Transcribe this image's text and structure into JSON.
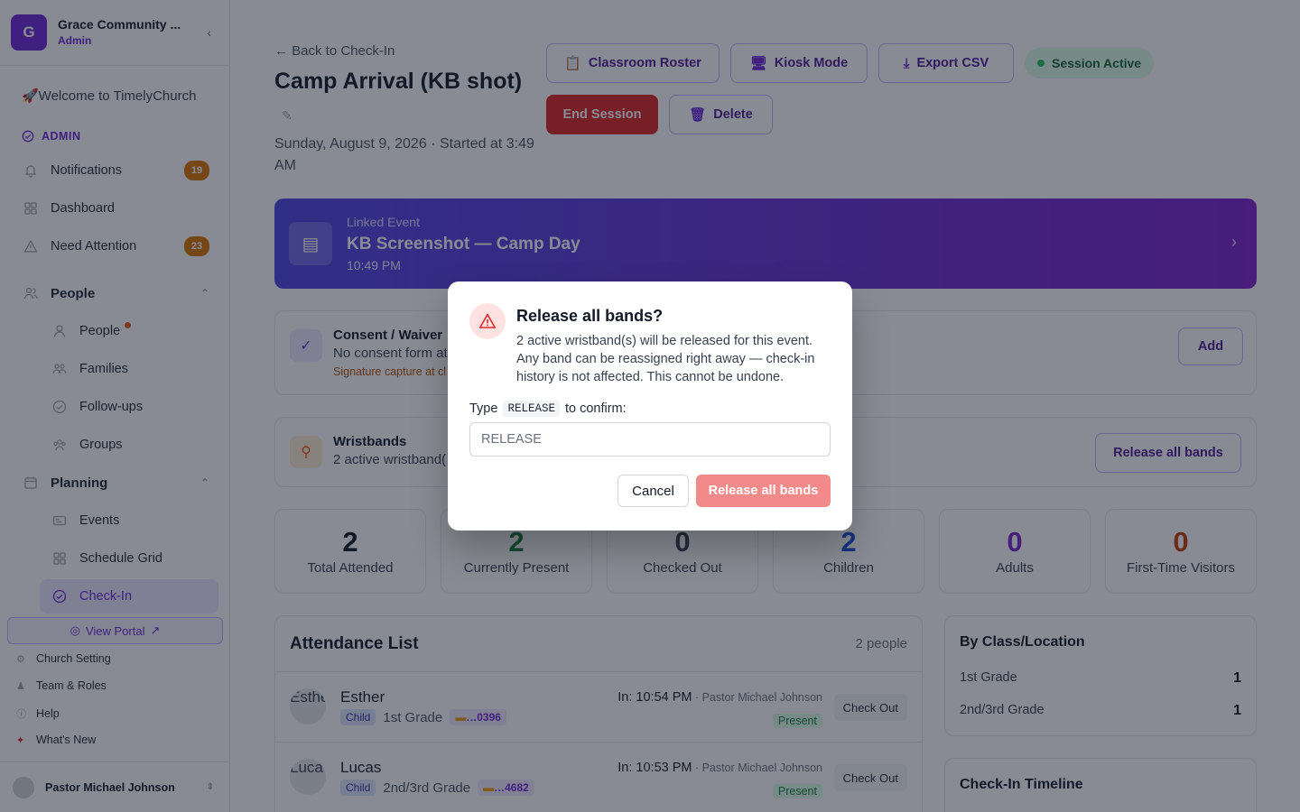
{
  "sidebar": {
    "org_initial": "G",
    "org_name": "Grace Community ...",
    "org_role": "Admin",
    "welcome": "🚀Welcome to TimelyChurch",
    "section_admin": "ADMIN",
    "notifications": {
      "label": "Notifications",
      "badge": "19"
    },
    "dashboard": "Dashboard",
    "need_attention": {
      "label": "Need Attention",
      "badge": "23"
    },
    "people_group": "People",
    "people_items": [
      "People",
      "Families",
      "Follow-ups",
      "Groups"
    ],
    "planning_group": "Planning",
    "planning_items": [
      "Events",
      "Schedule Grid",
      "Check-In"
    ],
    "view_portal": "View Portal",
    "footer": [
      "Church Setting",
      "Team & Roles",
      "Help",
      "What's New"
    ],
    "user_name": "Pastor Michael Johnson"
  },
  "header": {
    "back": "Back to Check-In",
    "title": "Camp Arrival (KB shot)",
    "subtitle": "Sunday, August 9, 2026 · Started at 3:49 AM",
    "buttons": {
      "roster": "Classroom Roster",
      "kiosk": "Kiosk Mode",
      "export": "Export CSV",
      "end": "End Session",
      "delete": "Delete"
    },
    "session_status": "Session Active"
  },
  "linked_event": {
    "label": "Linked Event",
    "name": "KB Screenshot — Camp Day",
    "time": "10:49 PM"
  },
  "consent": {
    "title": "Consent / Waiver",
    "sub": "No consent form at",
    "warn": "Signature capture at cl",
    "add": "Add"
  },
  "wristbands": {
    "title": "Wristbands",
    "sub": "2 active wristband(",
    "release": "Release all bands"
  },
  "stats": [
    {
      "num": "2",
      "label": "Total Attended",
      "color": "#111827"
    },
    {
      "num": "2",
      "label": "Currently Present",
      "color": "#15803d"
    },
    {
      "num": "0",
      "label": "Checked Out",
      "color": "#374151"
    },
    {
      "num": "2",
      "label": "Children",
      "color": "#1d4ed8"
    },
    {
      "num": "0",
      "label": "Adults",
      "color": "#7e22ce"
    },
    {
      "num": "0",
      "label": "First-Time Visitors",
      "color": "#c2410c"
    }
  ],
  "attendance": {
    "title": "Attendance List",
    "count": "2 people",
    "rows": [
      {
        "alt": "Esthe",
        "name": "Esther",
        "type": "Child",
        "grade": "1st Grade",
        "band": "…0396",
        "in": "In: 10:54 PM",
        "by": " · Pastor Michael Johnson",
        "status": "Present",
        "action": "Check Out"
      },
      {
        "alt": "Luca",
        "name": "Lucas",
        "type": "Child",
        "grade": "2nd/3rd Grade",
        "band": "…4682",
        "in": "In: 10:53 PM",
        "by": " · Pastor Michael Johnson",
        "status": "Present",
        "action": "Check Out"
      }
    ]
  },
  "by_class": {
    "title": "By Class/Location",
    "rows": [
      {
        "name": "1st Grade",
        "count": "1"
      },
      {
        "name": "2nd/3rd Grade",
        "count": "1"
      }
    ]
  },
  "timeline": {
    "title": "Check-In Timeline"
  },
  "modal": {
    "title": "Release all bands?",
    "body": "2 active wristband(s) will be released for this event. Any band can be reassigned right away — check-in history is not affected. This cannot be undone.",
    "label_prefix": "Type",
    "code": "RELEASE",
    "label_suffix": "to confirm:",
    "placeholder": "RELEASE",
    "cancel": "Cancel",
    "confirm": "Release all bands"
  }
}
